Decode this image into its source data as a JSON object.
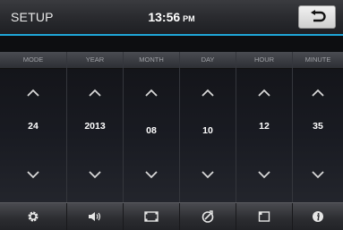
{
  "header": {
    "title": "SETUP",
    "time": "13:56",
    "ampm": "PM"
  },
  "columns": [
    {
      "label": "MODE",
      "value": "24"
    },
    {
      "label": "YEAR",
      "value": "2013"
    },
    {
      "label": "MONTH",
      "value": "08"
    },
    {
      "label": "DAY",
      "value": "10"
    },
    {
      "label": "HOUR",
      "value": "12"
    },
    {
      "label": "MINUTE",
      "value": "35"
    }
  ],
  "bottom_tabs": [
    "gear-icon",
    "speaker-icon",
    "screen-icon",
    "steering-icon",
    "display-icon",
    "info-icon"
  ],
  "colors": {
    "accent": "#1fa6d8"
  }
}
